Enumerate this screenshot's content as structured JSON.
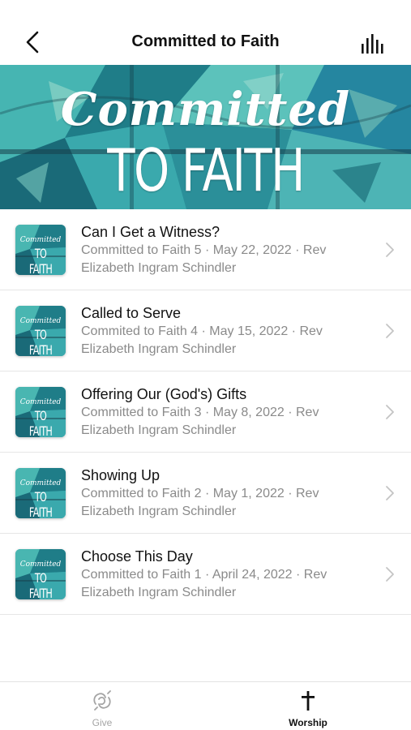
{
  "header": {
    "title": "Committed to Faith",
    "back_icon": "chevron-left-icon",
    "right_icon": "audio-bars-icon"
  },
  "hero": {
    "line1": "Committed",
    "line2": "TO FAITH",
    "colors": {
      "teal": "#2fa3a5",
      "deep": "#1d6f7a",
      "accent": "#6cc4c0"
    }
  },
  "thumb": {
    "line1": "Committed",
    "line2": "TO FAITH"
  },
  "sermons": [
    {
      "title": "Can I Get a Witness?",
      "meta_line1": "Committed to Faith 5 · May 22, 2022 · Rev",
      "meta_line2": "Elizabeth Ingram Schindler"
    },
    {
      "title": "Called to Serve",
      "meta_line1": "Commited to Faith 4 · May 15, 2022 · Rev",
      "meta_line2": "Elizabeth Ingram Schindler"
    },
    {
      "title": "Offering Our (God's) Gifts",
      "meta_line1": "Committed to Faith 3 · May 8, 2022 · Rev",
      "meta_line2": "Elizabeth Ingram Schindler"
    },
    {
      "title": "Showing Up",
      "meta_line1": "Committed to Faith 2 · May 1, 2022 · Rev",
      "meta_line2": "Elizabeth Ingram Schindler"
    },
    {
      "title": "Choose This Day",
      "meta_line1": "Committed to Faith 1 · April 24, 2022 · Rev",
      "meta_line2": "Elizabeth Ingram Schindler"
    }
  ],
  "tabbar": {
    "give": {
      "label": "Give",
      "icon": "give-hands-icon"
    },
    "worship": {
      "label": "Worship",
      "icon": "cross-icon"
    }
  }
}
